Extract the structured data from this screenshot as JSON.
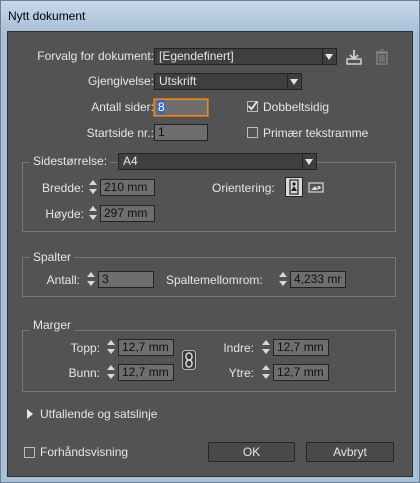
{
  "window": {
    "title": "Nytt dokument"
  },
  "top": {
    "preset_label": "Forvalg for dokument:",
    "preset_value": "[Egendefinert]",
    "intent_label": "Gjengivelse:",
    "intent_value": "Utskrift",
    "pages_label": "Antall sider:",
    "pages_value": "8",
    "start_label": "Startside nr.:",
    "start_value": "1",
    "facing_label": "Dobbeltsidig",
    "facing_checked": true,
    "primary_label": "Primær tekstramme",
    "primary_checked": false
  },
  "page_size": {
    "label": "Sidestørrelse:",
    "value": "A4",
    "width_label": "Bredde:",
    "width_value": "210 mm",
    "height_label": "Høyde:",
    "height_value": "297 mm",
    "orientation_label": "Orientering:"
  },
  "columns": {
    "title": "Spalter",
    "count_label": "Antall:",
    "count_value": "3",
    "gutter_label": "Spaltemellomrom:",
    "gutter_value": "4,233 mr"
  },
  "margins": {
    "title": "Marger",
    "top_label": "Topp:",
    "top_value": "12,7 mm",
    "bottom_label": "Bunn:",
    "bottom_value": "12,7 mm",
    "inside_label": "Indre:",
    "inside_value": "12,7 mm",
    "outside_label": "Ytre:",
    "outside_value": "12,7 mm"
  },
  "bleed": {
    "label": "Utfallende og satslinje"
  },
  "footer": {
    "preview_label": "Forhåndsvisning",
    "ok_label": "OK",
    "cancel_label": "Avbryt"
  }
}
